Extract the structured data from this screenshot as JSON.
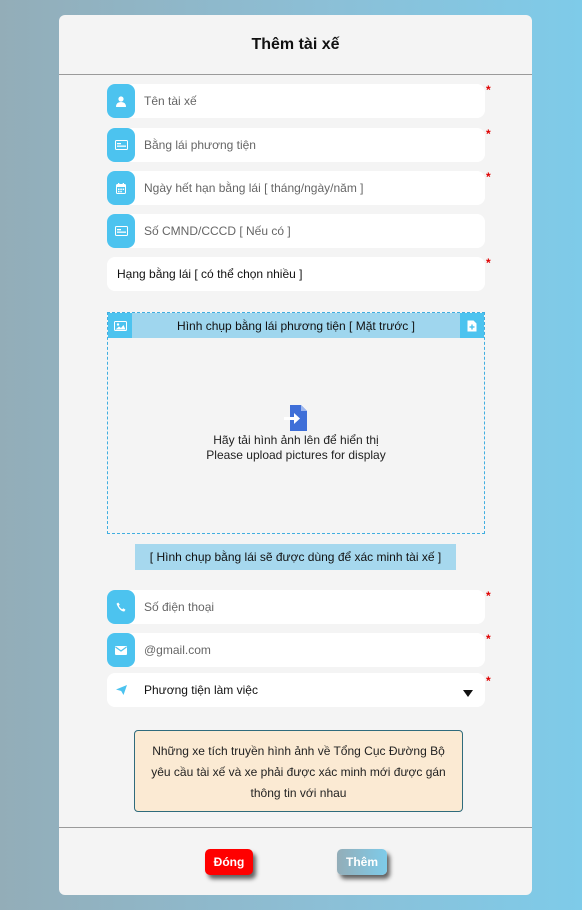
{
  "modal": {
    "title": "Thêm tài xế",
    "required_mark": "*"
  },
  "fields": {
    "driver_name": {
      "placeholder": "Tên tài xế",
      "icon": "user-icon"
    },
    "license": {
      "placeholder": "Bằng lái phương tiện",
      "icon": "id-card-icon"
    },
    "expiry": {
      "placeholder": "Ngày hết hạn bằng lái [ tháng/ngày/năm ]",
      "icon": "calendar-icon"
    },
    "id_number": {
      "placeholder": "Số CMND/CCCD [ Nếu có ]",
      "icon": "id-card-icon"
    },
    "license_class": {
      "label": "Hạng bằng lái [ có thể chọn nhiều ]"
    },
    "phone": {
      "placeholder": "Số điện thoại",
      "icon": "phone-icon"
    },
    "email": {
      "placeholder": "@gmail.com",
      "icon": "envelope-icon"
    },
    "vehicle": {
      "label": "Phương tiện làm việc",
      "icon": "paper-plane-icon"
    }
  },
  "upload": {
    "title": "Hình chụp bằng lái phương tiện [ Mặt trước ]",
    "line1": "Hãy tải hình ảnh lên để hiển thị",
    "line2": "Please upload pictures for display",
    "caption": "[ Hình chụp bằng lái sẽ được dùng để xác minh tài xế ]"
  },
  "note": {
    "text": "Những xe tích truyền hình ảnh về Tổng Cục Đường Bộ yêu cầu tài xế và xe phải được xác minh mới được gán thông tin với nhau"
  },
  "buttons": {
    "close": "Đóng",
    "add": "Thêm"
  },
  "colors": {
    "accent": "#4cc3ef",
    "required": "#e00000",
    "close": "#ff0000"
  }
}
